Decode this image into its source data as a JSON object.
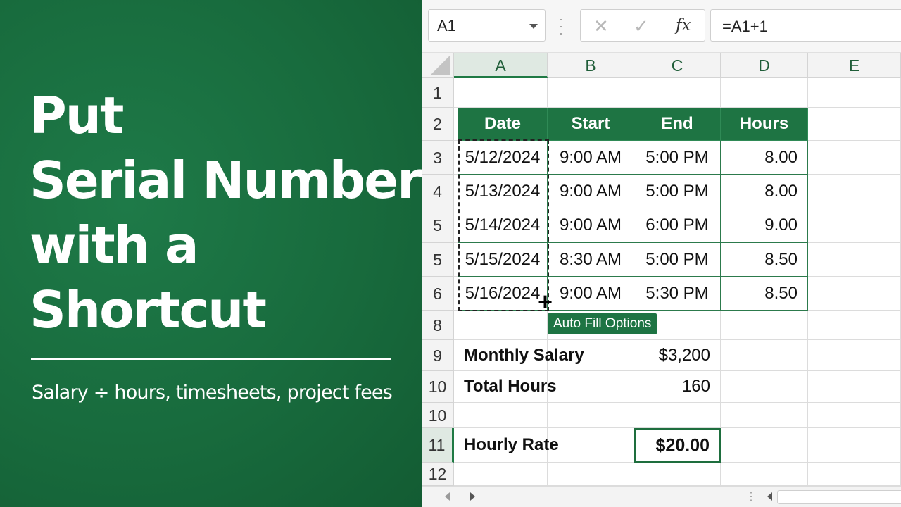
{
  "promo": {
    "title_lines": [
      "Put",
      "Serial Numbers",
      "with a",
      "Shortcut"
    ],
    "subtitle": "Salary ÷ hours, timesheets, project fees",
    "background_color": "#186b3d"
  },
  "formula_bar": {
    "name_box": "A1",
    "cancel_icon": "x-icon",
    "enter_icon": "check-icon",
    "function_label": "fx",
    "formula": "=A1+1"
  },
  "columns": [
    "A",
    "B",
    "C",
    "D",
    "E"
  ],
  "rows": [
    "1",
    "2",
    "3",
    "4",
    "5",
    "5",
    "6",
    "8",
    "9",
    "10",
    "10",
    "11",
    "12"
  ],
  "table": {
    "headers": [
      "Date",
      "Start",
      "End",
      "Hours"
    ],
    "rows": [
      [
        "5/12/2024",
        "9:00 AM",
        "5:00 PM",
        "8.00"
      ],
      [
        "5/13/2024",
        "9:00 AM",
        "5:00 PM",
        "8.00"
      ],
      [
        "5/14/2024",
        "9:00 AM",
        "6:00 PM",
        "9.00"
      ],
      [
        "5/15/2024",
        "8:30 AM",
        "5:00 PM",
        "8.50"
      ],
      [
        "5/16/2024",
        "9:00 AM",
        "5:30 PM",
        "8.50"
      ]
    ]
  },
  "summary": {
    "salary_label": "Monthly Salary",
    "salary_value": "$3,200",
    "hours_label": "Total Hours",
    "hours_value": "160",
    "rate_label": "Hourly Rate",
    "rate_value": "$20.00"
  },
  "autofill_label": "Auto Fill Options",
  "accent_color": "#1e7443"
}
